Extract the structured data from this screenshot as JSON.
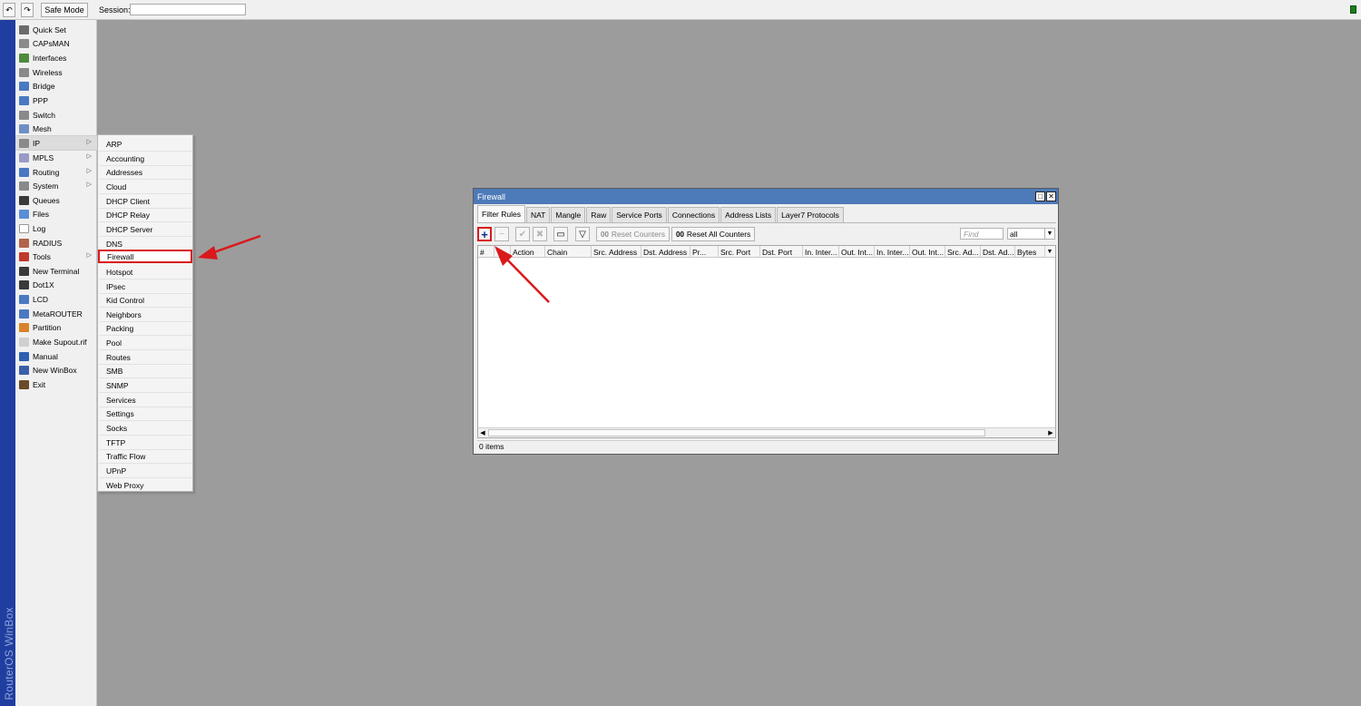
{
  "topbar": {
    "undo_icon": "undo-icon",
    "redo_icon": "redo-icon",
    "safe_mode_label": "Safe Mode",
    "session_label": "Session:",
    "session_value": "",
    "status_color": "#1c7d1c"
  },
  "brand": {
    "text": "RouterOS WinBox",
    "color": "#1f3ea0"
  },
  "sidebar": {
    "items": [
      {
        "label": "Quick Set",
        "icon": "quickset-icon",
        "color": "#6b6b6b"
      },
      {
        "label": "CAPsMAN",
        "icon": "antenna-icon",
        "color": "#8a8a8a"
      },
      {
        "label": "Interfaces",
        "icon": "interfaces-icon",
        "color": "#4e8b3e"
      },
      {
        "label": "Wireless",
        "icon": "antenna-icon",
        "color": "#8a8a8a"
      },
      {
        "label": "Bridge",
        "icon": "bridge-icon",
        "color": "#4a78c2"
      },
      {
        "label": "PPP",
        "icon": "ppp-icon",
        "color": "#4a78c2"
      },
      {
        "label": "Switch",
        "icon": "switch-icon",
        "color": "#8a8a8a"
      },
      {
        "label": "Mesh",
        "icon": "mesh-icon",
        "color": "#6e8ec4"
      },
      {
        "label": "IP",
        "icon": "ip-icon",
        "color": "#8a8a8a",
        "submenu": true
      },
      {
        "label": "MPLS",
        "icon": "mpls-icon",
        "color": "#9a9ac8",
        "submenu": true
      },
      {
        "label": "Routing",
        "icon": "routing-icon",
        "color": "#4a78c2",
        "submenu": true
      },
      {
        "label": "System",
        "icon": "gear-icon",
        "color": "#8a8a8a",
        "submenu": true
      },
      {
        "label": "Queues",
        "icon": "queues-icon",
        "color": "#3a3a3a"
      },
      {
        "label": "Files",
        "icon": "folder-icon",
        "color": "#5c8ed6"
      },
      {
        "label": "Log",
        "icon": "log-icon",
        "color": "#ffffff"
      },
      {
        "label": "RADIUS",
        "icon": "radius-icon",
        "color": "#b2634a"
      },
      {
        "label": "Tools",
        "icon": "tools-icon",
        "color": "#c0392b",
        "submenu": true
      },
      {
        "label": "New Terminal",
        "icon": "terminal-icon",
        "color": "#3a3a3a"
      },
      {
        "label": "Dot1X",
        "icon": "dot1x-icon",
        "color": "#3a3a3a"
      },
      {
        "label": "LCD",
        "icon": "lcd-icon",
        "color": "#4a78c2"
      },
      {
        "label": "MetaROUTER",
        "icon": "metarouter-icon",
        "color": "#4a78c2"
      },
      {
        "label": "Partition",
        "icon": "partition-icon",
        "color": "#d9822b"
      },
      {
        "label": "Make Supout.rif",
        "icon": "supout-icon",
        "color": "#cfcfcf"
      },
      {
        "label": "Manual",
        "icon": "help-icon",
        "color": "#2f5fb0"
      },
      {
        "label": "New WinBox",
        "icon": "winbox-icon",
        "color": "#3a5fa8"
      },
      {
        "label": "Exit",
        "icon": "exit-icon",
        "color": "#6b4a2a"
      }
    ]
  },
  "ip_submenu": {
    "items": [
      "ARP",
      "Accounting",
      "Addresses",
      "Cloud",
      "DHCP Client",
      "DHCP Relay",
      "DHCP Server",
      "DNS",
      "Firewall",
      "Hotspot",
      "IPsec",
      "Kid Control",
      "Neighbors",
      "Packing",
      "Pool",
      "Routes",
      "SMB",
      "SNMP",
      "Services",
      "Settings",
      "Socks",
      "TFTP",
      "Traffic Flow",
      "UPnP",
      "Web Proxy"
    ],
    "highlighted": "Firewall"
  },
  "firewall": {
    "title": "Firewall",
    "tabs": [
      "Filter Rules",
      "NAT",
      "Mangle",
      "Raw",
      "Service Ports",
      "Connections",
      "Address Lists",
      "Layer7 Protocols"
    ],
    "active_tab": "Filter Rules",
    "toolbar": {
      "add_icon": "plus-icon",
      "remove_icon": "minus-icon",
      "enable_icon": "check-icon",
      "disable_icon": "x-icon",
      "comment_icon": "comment-icon",
      "filter_icon": "filter-icon",
      "reset_counters": "Reset Counters",
      "reset_all_counters": "Reset All Counters",
      "counter_prefix": "00",
      "find_placeholder": "Find",
      "filter_value": "all"
    },
    "columns": [
      "#",
      "",
      "Action",
      "Chain",
      "Src. Address",
      "Dst. Address",
      "Pr...",
      "Src. Port",
      "Dst. Port",
      "In. Inter...",
      "Out. Int...",
      "In. Inter...",
      "Out. Int...",
      "Src. Ad...",
      "Dst. Ad...",
      "Bytes"
    ],
    "rows": [],
    "status": "0 items"
  },
  "colors": {
    "annotation": "#d9191c",
    "title_bar": "#4d7ab8",
    "desktop": "#9c9c9c"
  }
}
